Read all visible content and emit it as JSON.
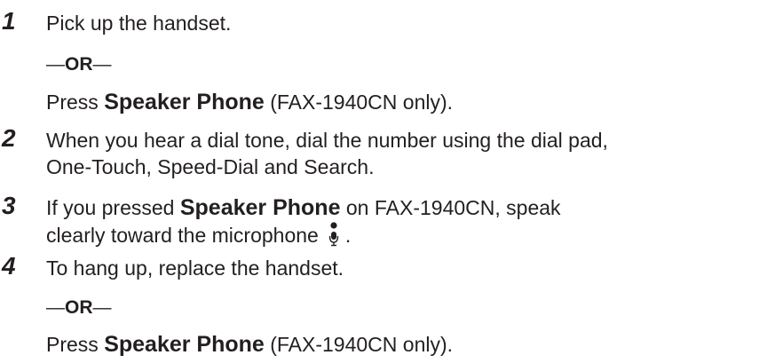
{
  "steps": [
    {
      "number": "1",
      "text": "Pick up the handset.",
      "or": "OR",
      "alt_prefix": "Press ",
      "alt_bold": "Speaker Phone",
      "alt_suffix": " (FAX-1940CN only)."
    },
    {
      "number": "2",
      "line1": "When you hear a dial tone, dial the number using the dial pad,",
      "line2": "One-Touch, Speed-Dial and Search."
    },
    {
      "number": "3",
      "line1_prefix": "If you pressed ",
      "line1_bold": "Speaker Phone",
      "line1_suffix": " on FAX-1940CN, speak",
      "line2_text": "clearly toward the microphone",
      "line2_end": ".",
      "icon": "microphone-icon"
    },
    {
      "number": "4",
      "text": "To hang up, replace the handset.",
      "or": "OR",
      "alt_prefix": "Press ",
      "alt_bold": "Speaker Phone",
      "alt_suffix": " (FAX-1940CN only)."
    }
  ],
  "dash": "—"
}
